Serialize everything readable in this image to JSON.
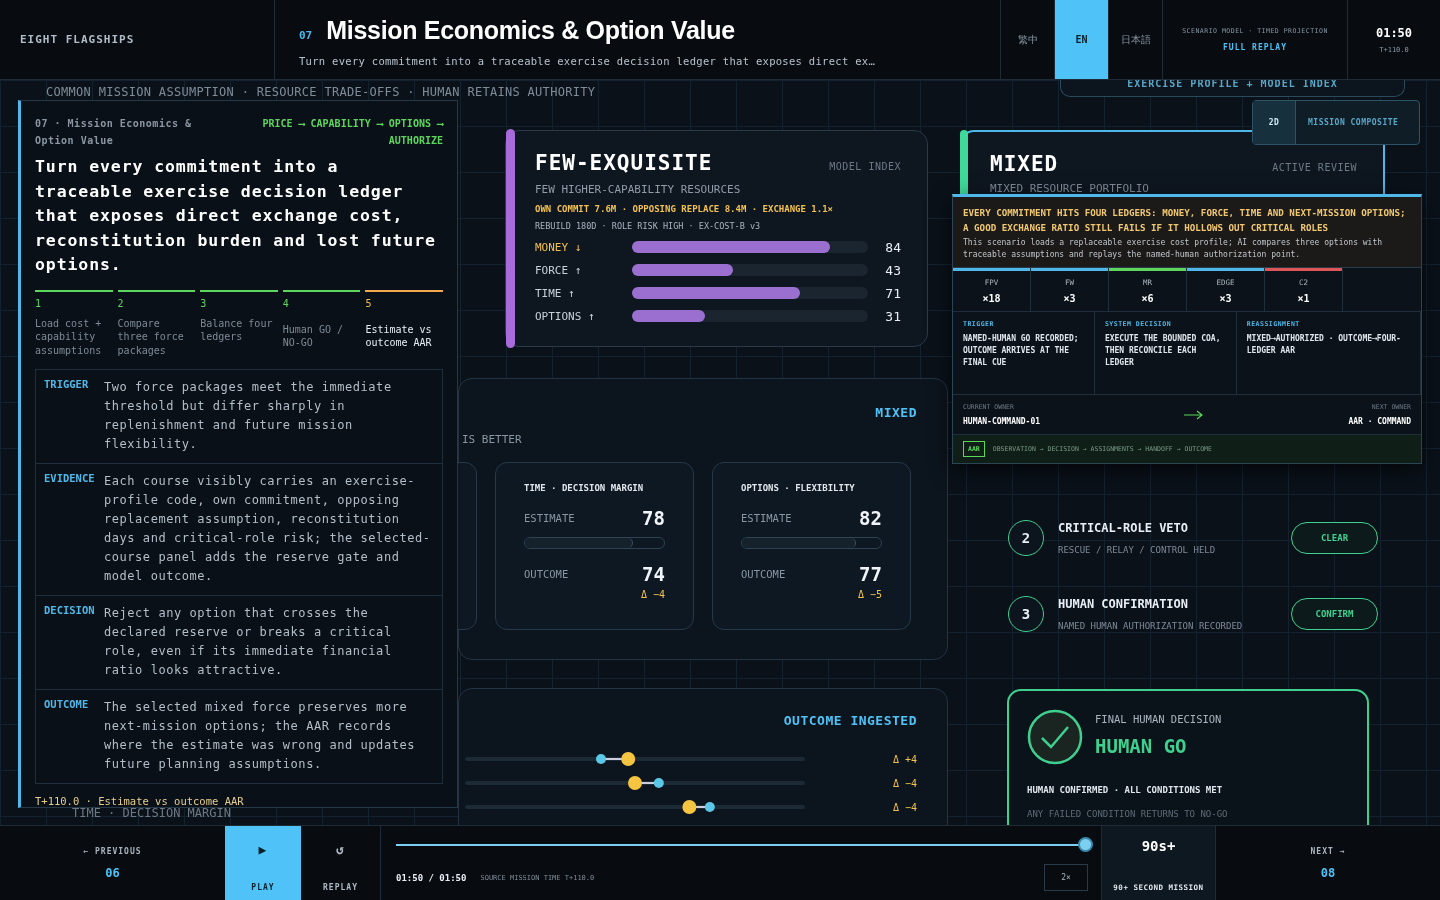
{
  "header": {
    "back": "EIGHT FLAGSHIPS",
    "number": "07",
    "title": "Mission Economics & Option Value",
    "subtitle": "Turn every commitment into a traceable exercise decision ledger that exposes direct ex…",
    "languages": [
      {
        "label": "繁中",
        "selected": false
      },
      {
        "label": "EN",
        "selected": true
      },
      {
        "label": "日本語",
        "selected": false
      }
    ],
    "mode_caption": "SCENARIO MODEL · TIMED PROJECTION",
    "mode": "FULL REPLAY",
    "clock": "01:50",
    "clock_offset": "T+110.0"
  },
  "stage": {
    "strip": "COMMON MISSION ASSUMPTION · RESOURCE TRADE-OFFS · HUMAN RETAINS AUTHORITY",
    "profile_tab": "EXERCISE PROFILE + MODEL INDEX",
    "view_toggle": [
      {
        "label": "2D",
        "selected": true
      },
      {
        "label": "MISSION COMPOSITE",
        "selected": false
      }
    ],
    "behind_label": "TIME · DECISION MARGIN"
  },
  "brief": {
    "kicker": "07 · Mission Economics & Option Value",
    "flow": "PRICE ⟶ CAPABILITY ⟶ OPTIONS ⟶ AUTHORIZE",
    "headline": "Turn every commitment into a traceable exercise decision ledger that exposes direct exchange cost, reconstitution burden and lost future options.",
    "steps": [
      {
        "number": "1",
        "label": "Load cost + capability assumptions",
        "current": false
      },
      {
        "number": "2",
        "label": "Compare three force packages",
        "current": false
      },
      {
        "number": "3",
        "label": "Balance four ledgers",
        "current": false
      },
      {
        "number": "4",
        "label": "Human GO / NO-GO",
        "current": false
      },
      {
        "number": "5",
        "label": "Estimate vs outcome AAR",
        "current": true
      }
    ],
    "sections": [
      {
        "tag": "TRIGGER",
        "text": "Two force packages meet the immediate threshold but differ sharply in replenishment and future mission flexibility."
      },
      {
        "tag": "EVIDENCE",
        "text": "Each course visibly carries an exercise-profile code, own commitment, opposing replacement assumption, reconstitution days and critical-role risk; the selected-course panel adds the reserve gate and model outcome."
      },
      {
        "tag": "DECISION",
        "text": "Reject any option that crosses the declared reserve or breaks a critical role, even if its immediate financial ratio looks attractive."
      },
      {
        "tag": "OUTCOME",
        "text": "The selected mixed force preserves more next-mission options; the AAR records where the estimate was wrong and updates future planning assumptions."
      }
    ],
    "footer": "T+110.0 · Estimate vs outcome AAR"
  },
  "option_card": {
    "name": "FEW-EXQUISITE",
    "tag": "MODEL INDEX",
    "subtitle": "FEW HIGHER-CAPABILITY RESOURCES",
    "costs": "OWN COMMIT 7.6M · OPPOSING REPLACE 8.4M · EXCHANGE 1.1×",
    "meta": "REBUILD 180D · ROLE RISK HIGH · EX-COST-B v3",
    "ledgers": [
      {
        "label": "MONEY ↓",
        "emphasized": true,
        "level": 0.84,
        "value": "84"
      },
      {
        "label": "FORCE ↑",
        "emphasized": false,
        "level": 0.43,
        "value": "43"
      },
      {
        "label": "TIME ↑",
        "emphasized": false,
        "level": 0.71,
        "value": "71"
      },
      {
        "label": "OPTIONS ↑",
        "emphasized": false,
        "level": 0.31,
        "value": "31"
      }
    ]
  },
  "selected_card": {
    "name": "MIXED",
    "tag": "ACTIVE REVIEW",
    "subtitle": "MIXED RESOURCE PORTFOLIO"
  },
  "comparison": {
    "heading": "MIXED",
    "partial_label": "IS BETTER",
    "metrics": [
      {
        "title": "TIME · DECISION MARGIN",
        "estimate_label": "ESTIMATE",
        "estimate": "78",
        "level": 0.78,
        "outcome_label": "OUTCOME",
        "outcome": "74",
        "delta": "Δ −4"
      },
      {
        "title": "OPTIONS · FLEXIBILITY",
        "estimate_label": "ESTIMATE",
        "estimate": "82",
        "level": 0.82,
        "outcome_label": "OUTCOME",
        "outcome": "77",
        "delta": "Δ −5"
      }
    ]
  },
  "ingest": {
    "heading": "OUTCOME INGESTED",
    "rows": [
      {
        "delta": "Δ +4"
      },
      {
        "delta": "Δ −4"
      },
      {
        "delta": "Δ −4"
      }
    ]
  },
  "tooltip": {
    "headline": "EVERY COMMITMENT HITS FOUR LEDGERS: MONEY, FORCE, TIME AND NEXT-MISSION OPTIONS; A GOOD EXCHANGE RATIO STILL FAILS IF IT HOLLOWS OUT CRITICAL ROLES",
    "body": "This scenario loads a replaceable exercise cost profile; AI compares three options with traceable assumptions and replays the named-human authorization point.",
    "assets": [
      {
        "label": "FPV",
        "count": "×18",
        "color": "#4fb8e8"
      },
      {
        "label": "FW",
        "count": "×3",
        "color": "#4fb8e8"
      },
      {
        "label": "MR",
        "count": "×6",
        "color": "#5cd65c"
      },
      {
        "label": "EDGE",
        "count": "×3",
        "color": "#4fb8e8"
      },
      {
        "label": "C2",
        "count": "×1",
        "color": "#e05555"
      }
    ],
    "columns": [
      {
        "title": "TRIGGER",
        "text": "NAMED-HUMAN GO RECORDED; OUTCOME ARRIVES AT THE FINAL CUE"
      },
      {
        "title": "SYSTEM DECISION",
        "text": "EXECUTE THE BOUNDED COA, THEN RECONCILE EACH LEDGER"
      },
      {
        "title": "REASSIGNMENT",
        "text": "MIXED⟶AUTHORIZED · OUTCOME⟶FOUR-LEDGER AAR"
      }
    ],
    "current_owner_label": "CURRENT OWNER",
    "current_owner": "HUMAN-COMMAND-01",
    "next_owner_label": "NEXT OWNER",
    "next_owner": "AAR · COMMAND",
    "aar_tag": "AAR",
    "aar_chain": "OBSERVATION → DECISION → ASSIGNMENTS → HANDOFF → OUTCOME"
  },
  "checks": [
    {
      "number": "2",
      "title": "CRITICAL-ROLE VETO",
      "detail": "RESCUE / RELAY / CONTROL HELD",
      "action": "CLEAR"
    },
    {
      "number": "3",
      "title": "HUMAN CONFIRMATION",
      "detail": "NAMED HUMAN AUTHORIZATION RECORDED",
      "action": "CONFIRM"
    }
  ],
  "decision": {
    "caption": "FINAL HUMAN DECISION",
    "verdict": "HUMAN GO",
    "status": "HUMAN CONFIRMED · ALL CONDITIONS MET",
    "note": "ANY FAILED CONDITION RETURNS TO NO-GO"
  },
  "player": {
    "previous_label": "← PREVIOUS",
    "previous": "06",
    "play_icon": "▶",
    "play": "PLAY",
    "play_selected": true,
    "replay_icon": "↺",
    "replay": "REPLAY",
    "time": "01:50 / 01:50",
    "source": "SOURCE MISSION TIME T+110.0",
    "level": 1.0,
    "speed": "2×",
    "duration": "90s+",
    "duration_label": "90+ SECOND MISSION",
    "next_label": "NEXT →",
    "next": "08"
  }
}
